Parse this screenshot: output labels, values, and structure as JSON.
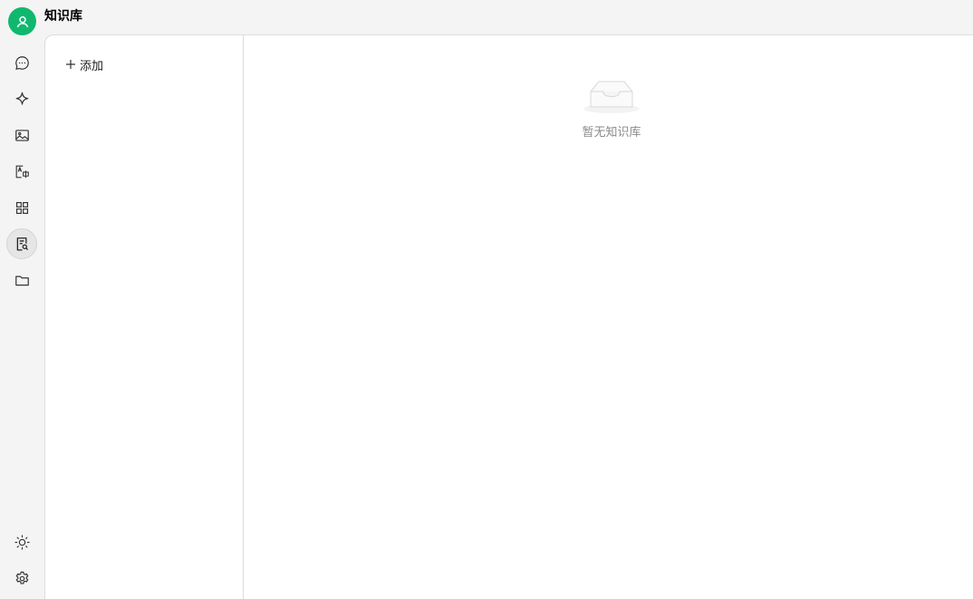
{
  "header": {
    "title": "知识库",
    "avatar_icon": "user-icon",
    "avatar_color": "#10b86e"
  },
  "rail": {
    "items": [
      {
        "icon": "chat-bubble-icon",
        "active": false
      },
      {
        "icon": "sparkle-icon",
        "active": false
      },
      {
        "icon": "image-icon",
        "active": false
      },
      {
        "icon": "translate-icon",
        "active": false
      },
      {
        "icon": "grid-apps-icon",
        "active": false
      },
      {
        "icon": "knowledge-search-icon",
        "active": true
      },
      {
        "icon": "folder-icon",
        "active": false
      }
    ],
    "bottom_items": [
      {
        "icon": "sun-icon"
      },
      {
        "icon": "settings-gear-icon"
      }
    ]
  },
  "list_pane": {
    "add_label": "添加",
    "add_icon": "plus-icon"
  },
  "detail_pane": {
    "empty_icon": "empty-inbox-icon",
    "empty_text": "暂无知识库"
  }
}
